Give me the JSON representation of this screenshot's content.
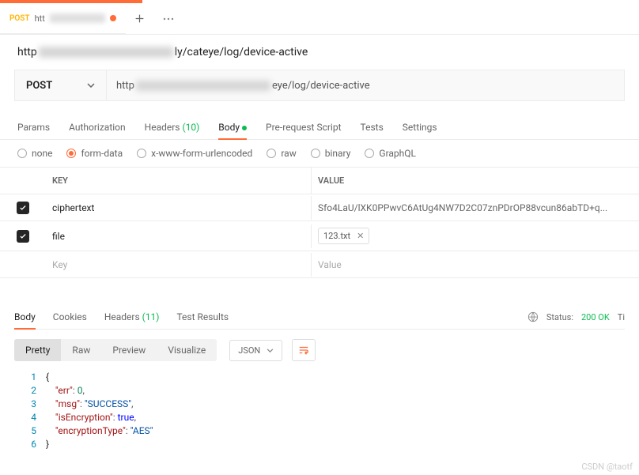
{
  "tab": {
    "method": "POST",
    "label_prefix": "htt"
  },
  "url_display": {
    "prefix": "http",
    "suffix": "ly/cateye/log/device-active"
  },
  "method_dropdown": "POST",
  "url_input": {
    "prefix": "http",
    "suffix": "eye/log/device-active"
  },
  "request_tabs": {
    "params": "Params",
    "authorization": "Authorization",
    "headers_label": "Headers",
    "headers_count": "(10)",
    "body": "Body",
    "pre_request": "Pre-request Script",
    "tests": "Tests",
    "settings": "Settings"
  },
  "body_types": {
    "none": "none",
    "form_data": "form-data",
    "urlencoded": "x-www-form-urlencoded",
    "raw": "raw",
    "binary": "binary",
    "graphql": "GraphQL"
  },
  "kv": {
    "key_header": "KEY",
    "value_header": "VALUE",
    "rows": [
      {
        "key": "ciphertext",
        "value": "Sfo4LaU/lXK0PPwvC6AtUg4NW7D2C07znPDrOP88vcun86abTD+q..."
      },
      {
        "key": "file",
        "file": "123.txt"
      }
    ],
    "placeholder_key": "Key",
    "placeholder_value": "Value"
  },
  "response_tabs": {
    "body": "Body",
    "cookies": "Cookies",
    "headers_label": "Headers",
    "headers_count": "(11)",
    "test_results": "Test Results"
  },
  "status": {
    "label": "Status:",
    "code": "200 OK",
    "trailing": "Ti"
  },
  "view_tabs": {
    "pretty": "Pretty",
    "raw": "Raw",
    "preview": "Preview",
    "visualize": "Visualize"
  },
  "format_dd": "JSON",
  "response_body": {
    "err": 0,
    "msg": "SUCCESS",
    "isEncryption": true,
    "encryptionType": "AES"
  },
  "code_lines": [
    {
      "n": "1",
      "html": "<span class='tk-brace'>{</span>"
    },
    {
      "n": "2",
      "html": "    <span class='tk-key'>\"err\"</span><span class='tk-punc'>: </span><span class='tk-num'>0</span><span class='tk-punc'>,</span>"
    },
    {
      "n": "3",
      "html": "    <span class='tk-key'>\"msg\"</span><span class='tk-punc'>: </span><span class='tk-str'>\"SUCCESS\"</span><span class='tk-punc'>,</span>"
    },
    {
      "n": "4",
      "html": "    <span class='tk-key'>\"isEncryption\"</span><span class='tk-punc'>: </span><span class='tk-bool'>true</span><span class='tk-punc'>,</span>"
    },
    {
      "n": "5",
      "html": "    <span class='tk-key'>\"encryptionType\"</span><span class='tk-punc'>: </span><span class='tk-str'>\"AES\"</span>"
    },
    {
      "n": "6",
      "html": "<span class='tk-brace'>}</span>"
    }
  ],
  "watermark": "CSDN @taotf"
}
